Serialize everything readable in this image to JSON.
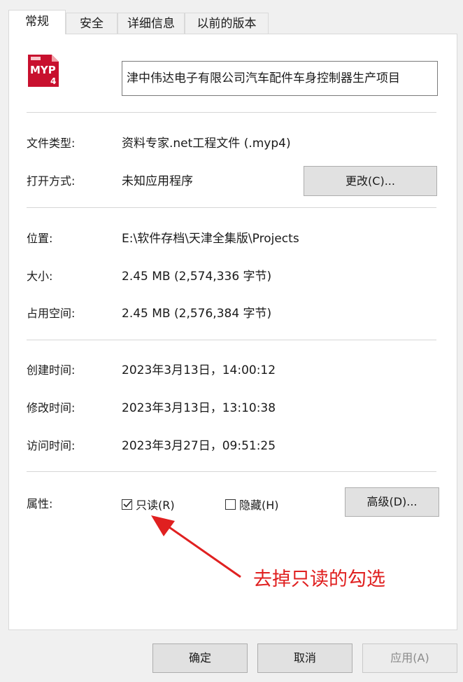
{
  "tabs": [
    "常规",
    "安全",
    "详细信息",
    "以前的版本"
  ],
  "file": {
    "icon_name": "myp4-file-icon",
    "icon_text_top": "MYP",
    "icon_text_bottom": "4",
    "name": "津中伟达电子有限公司汽车配件车身控制器生产项目"
  },
  "type_section": {
    "file_type_label": "文件类型:",
    "file_type_value": "资料专家.net工程文件 (.myp4)",
    "open_with_label": "打开方式:",
    "open_with_value": "未知应用程序",
    "change_button": "更改(C)..."
  },
  "location_section": {
    "location_label": "位置:",
    "location_value": "E:\\软件存档\\天津全集版\\Projects",
    "size_label": "大小:",
    "size_value": "2.45 MB (2,574,336 字节)",
    "disk_size_label": "占用空间:",
    "disk_size_value": "2.45 MB (2,576,384 字节)"
  },
  "time_section": {
    "created_label": "创建时间:",
    "created_value": "2023年3月13日，14:00:12",
    "modified_label": "修改时间:",
    "modified_value": "2023年3月13日，13:10:38",
    "accessed_label": "访问时间:",
    "accessed_value": "2023年3月27日，09:51:25"
  },
  "attributes": {
    "label": "属性:",
    "readonly_label": "只读(R)",
    "readonly_checked": true,
    "hidden_label": "隐藏(H)",
    "hidden_checked": false,
    "advanced_button": "高级(D)..."
  },
  "annotation": {
    "text": "去掉只读的勾选",
    "color": "#e02020"
  },
  "footer": {
    "ok_button": "确定",
    "cancel_button": "取消",
    "apply_button": "应用(A)"
  }
}
